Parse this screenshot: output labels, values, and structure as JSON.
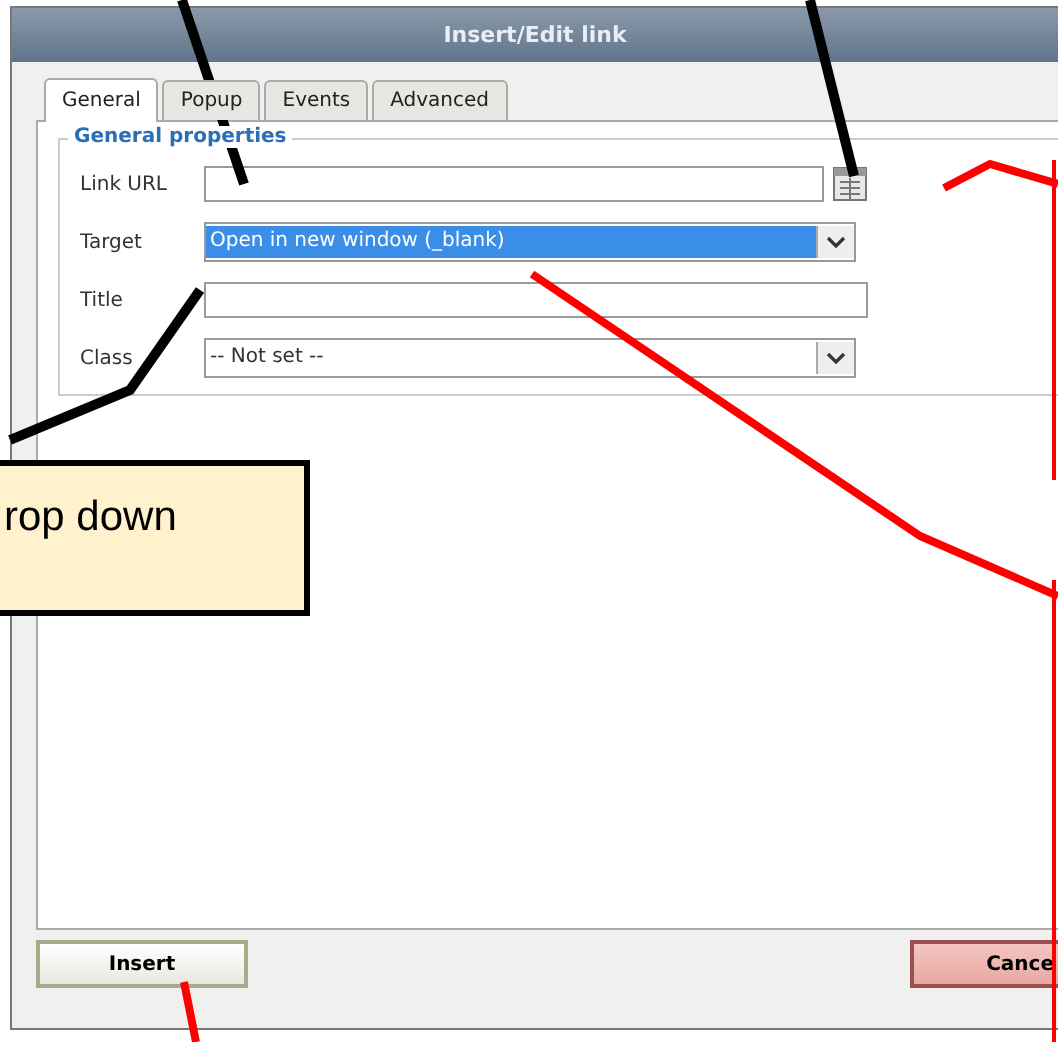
{
  "window": {
    "title": "Insert/Edit link"
  },
  "tabs": [
    {
      "label": "General",
      "selected": true
    },
    {
      "label": "Popup",
      "selected": false
    },
    {
      "label": "Events",
      "selected": false
    },
    {
      "label": "Advanced",
      "selected": false
    }
  ],
  "fieldset": {
    "legend": "General properties",
    "fields": [
      {
        "kind": "text",
        "label": "Link URL",
        "browse": true
      },
      {
        "kind": "select",
        "label": "Target",
        "value": "Open in new window (_blank)",
        "highlighted": true
      },
      {
        "kind": "text",
        "label": "Title",
        "browse": false
      },
      {
        "kind": "select",
        "label": "Class",
        "value": "-- Not set --",
        "highlighted": false
      }
    ]
  },
  "buttons": [
    {
      "label": "Insert",
      "kind": "primary"
    },
    {
      "label": "Cance",
      "kind": "cancel"
    }
  ],
  "callout": {
    "text": "rop down"
  }
}
